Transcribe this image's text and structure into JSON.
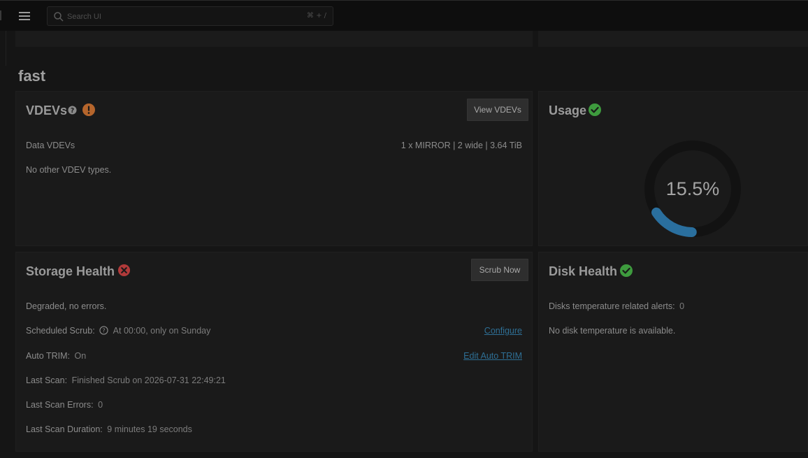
{
  "search": {
    "placeholder": "Search UI",
    "shortcut": "⌘ + /"
  },
  "pool": {
    "name": "fast"
  },
  "vdevs": {
    "title": "VDEVs",
    "button": "View VDEVs",
    "data_label": "Data VDEVs",
    "data_value": "1 x MIRROR | 2 wide | 3.64 TiB",
    "other_note": "No other VDEV types.",
    "warning_icon": "exclamation-circle-icon",
    "warning_color": "#b5652c"
  },
  "usage": {
    "title": "Usage",
    "percent_text": "15.5%",
    "percent": 15.5,
    "status_icon": "check-circle-icon",
    "gauge_color": "#2a6f9e",
    "ok_color": "#3e9b3e"
  },
  "storage_health": {
    "title": "Storage Health",
    "button": "Scrub Now",
    "status_icon": "x-circle-icon",
    "error_color": "#b13a3a",
    "status_text": "Degraded, no errors.",
    "scheduled_scrub_label": "Scheduled Scrub:",
    "scheduled_scrub_value": "At 00:00, only on Sunday",
    "configure_link": "Configure",
    "auto_trim_label": "Auto TRIM:",
    "auto_trim_value": "On",
    "edit_auto_trim_link": "Edit Auto TRIM",
    "last_scan_label": "Last Scan:",
    "last_scan_value": "Finished Scrub on 2026-07-31 22:49:21",
    "last_scan_errors_label": "Last Scan Errors:",
    "last_scan_errors_value": "0",
    "last_scan_duration_label": "Last Scan Duration:",
    "last_scan_duration_value": "9 minutes 19 seconds"
  },
  "disk_health": {
    "title": "Disk Health",
    "status_icon": "check-circle-icon",
    "temp_alerts_label": "Disks temperature related alerts:",
    "temp_alerts_value": "0",
    "temp_note": "No disk temperature is available."
  }
}
